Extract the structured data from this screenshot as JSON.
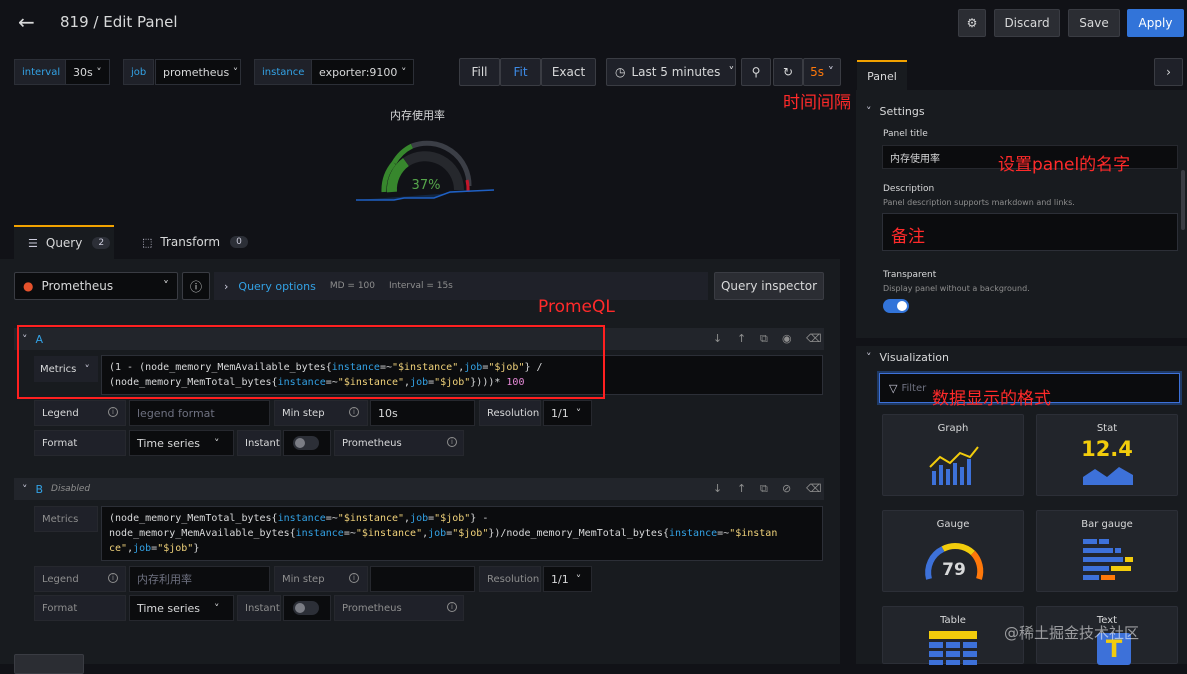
{
  "header": {
    "title": "819 / Edit Panel",
    "discard": "Discard",
    "save": "Save",
    "apply": "Apply"
  },
  "vars": {
    "interval_label": "interval",
    "interval_value": "30s",
    "job_label": "job",
    "job_value": "prometheus",
    "instance_label": "instance",
    "instance_value": "exporter:9100"
  },
  "viewmode": {
    "fill": "Fill",
    "fit": "Fit",
    "exact": "Exact"
  },
  "time": {
    "range": "Last 5 minutes",
    "refresh": "5s"
  },
  "preview": {
    "title": "内存使用率",
    "gauge_value": "37%",
    "gauge_percent": 37
  },
  "annotations": {
    "time_interval": "时间间隔",
    "panel_name": "设置panel的名字",
    "remark": "备注",
    "promql": "PromeQL",
    "data_format": "数据显示的格式"
  },
  "tabs": {
    "query": "Query",
    "query_count": "2",
    "transform": "Transform",
    "transform_count": "0"
  },
  "query_bar": {
    "datasource": "Prometheus",
    "query_options": "Query options",
    "md": "MD = 100",
    "interval": "Interval = 15s",
    "inspector": "Query inspector"
  },
  "query_a": {
    "name": "A",
    "metrics_label": "Metrics",
    "legend_label": "Legend",
    "legend_placeholder": "legend format",
    "minstep_label": "Min step",
    "minstep_value": "10s",
    "resolution_label": "Resolution",
    "resolution_value": "1/1",
    "format_label": "Format",
    "format_value": "Time series",
    "instant_label": "Instant",
    "prometheus_label": "Prometheus"
  },
  "query_b": {
    "name": "B",
    "disabled": "Disabled",
    "metrics_label": "Metrics",
    "legend_label": "Legend",
    "legend_value": "内存利用率",
    "minstep_label": "Min step",
    "resolution_label": "Resolution",
    "resolution_value": "1/1",
    "format_label": "Format",
    "format_value": "Time series",
    "instant_label": "Instant",
    "prometheus_label": "Prometheus"
  },
  "side": {
    "tab": "Panel",
    "settings": "Settings",
    "panel_title_label": "Panel title",
    "panel_title_value": "内存使用率",
    "description_label": "Description",
    "description_hint": "Panel description supports markdown and links.",
    "transparent_label": "Transparent",
    "transparent_hint": "Display panel without a background.",
    "visualization": "Visualization",
    "filter_placeholder": "Filter"
  },
  "viz": [
    {
      "name": "Graph"
    },
    {
      "name": "Stat",
      "value": "12.4"
    },
    {
      "name": "Gauge",
      "value": "79"
    },
    {
      "name": "Bar gauge"
    },
    {
      "name": "Table"
    },
    {
      "name": "Text"
    }
  ],
  "watermark": "@稀土掘金技术社区",
  "colors": {
    "accent": "#3d71d9",
    "apply": "#3274d9",
    "gauge_green": "#37872d",
    "red_annotation": "#ff2a2a"
  }
}
